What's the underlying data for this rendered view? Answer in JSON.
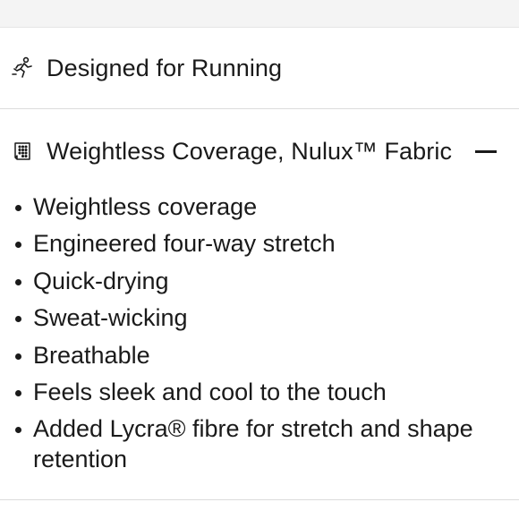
{
  "sections": {
    "running": {
      "label": "Designed for Running",
      "icon": "running-person-icon"
    },
    "fabric": {
      "label": "Weightless Coverage, Nulux™ Fabric",
      "icon": "fabric-swatch-icon",
      "toggle_icon": "minus-collapse-icon",
      "expanded": true,
      "features": [
        "Weightless coverage",
        "Engineered four-way stretch",
        "Quick-drying",
        "Sweat-wicking",
        "Breathable",
        "Feels sleek and cool to the touch",
        "Added Lycra® fibre for stretch and shape retention"
      ]
    }
  },
  "colors": {
    "text": "#1a1a1a",
    "divider": "#dcdcdc",
    "top_band": "#f4f4f4"
  }
}
